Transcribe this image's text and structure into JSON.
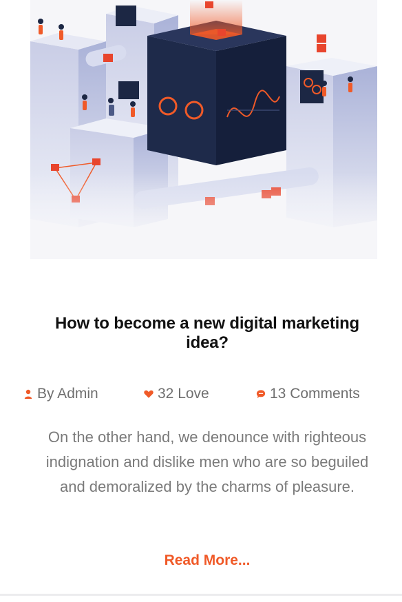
{
  "post": {
    "title": "How to become a new digital marketing idea?",
    "author": "By Admin",
    "likes": "32 Love",
    "comments": "13 Comments",
    "excerpt": "On the other hand, we denounce with righteous indignation and dislike men who are so beguiled and demoralized by the charms of pleasure.",
    "read_more": "Read More..."
  },
  "icons": {
    "author": "user-icon",
    "likes": "heart-icon",
    "comments": "comment-icon"
  },
  "colors": {
    "accent": "#f05a28",
    "title": "#111111",
    "text": "#7a7a7a",
    "meta": "#6f6f6f"
  }
}
